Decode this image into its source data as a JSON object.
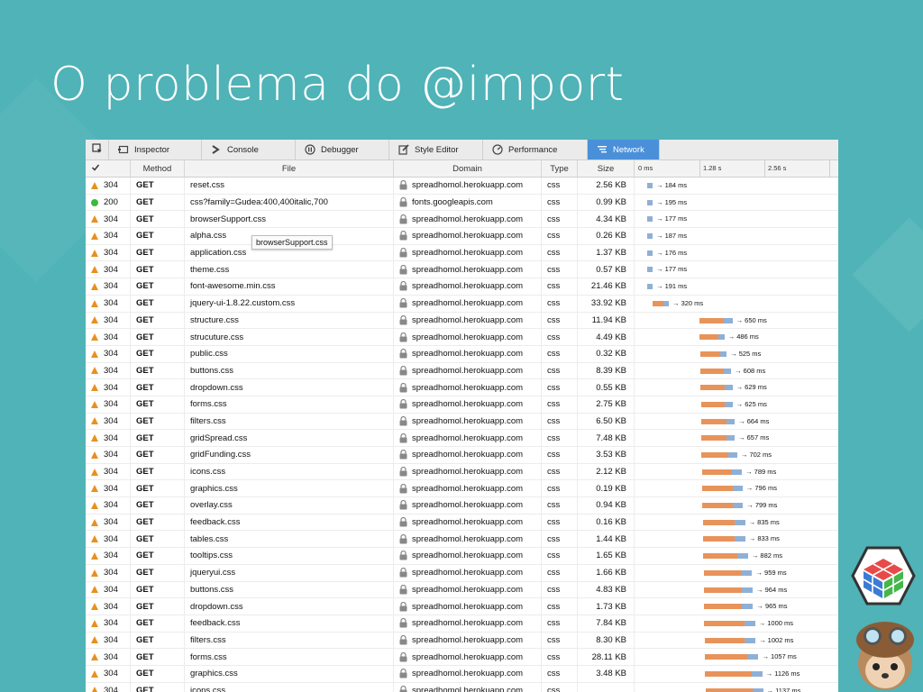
{
  "slide": {
    "title": "O problema do @import"
  },
  "toolbar": {
    "tabs": [
      {
        "label": "Inspector",
        "icon": "inspector-icon"
      },
      {
        "label": "Console",
        "icon": "console-icon"
      },
      {
        "label": "Debugger",
        "icon": "debugger-icon"
      },
      {
        "label": "Style Editor",
        "icon": "style-editor-icon"
      },
      {
        "label": "Performance",
        "icon": "performance-icon"
      },
      {
        "label": "Network",
        "icon": "network-icon",
        "active": true
      }
    ]
  },
  "columns": {
    "method": "Method",
    "file": "File",
    "domain": "Domain",
    "type": "Type",
    "size": "Size",
    "ticks": [
      "0 ms",
      "1.28 s",
      "2.56 s"
    ]
  },
  "tooltip": "browserSupport.css",
  "colors": {
    "background": "#4fb3b7",
    "wait": "#e8935a",
    "receive": "#8fb0d6",
    "warning": "#e8901f",
    "ok": "#3cba3c",
    "active_tab": "#4a90d9"
  },
  "requests": [
    {
      "status": "304",
      "method": "GET",
      "file": "reset.css",
      "domain": "spreadhomol.herokuapp.com",
      "type": "css",
      "size": "2.56 KB",
      "time": "→ 184 ms"
    },
    {
      "status": "200",
      "method": "GET",
      "file": "css?family=Gudea:400,400italic,700",
      "domain": "fonts.googleapis.com",
      "type": "css",
      "size": "0.99 KB",
      "time": "→ 195 ms"
    },
    {
      "status": "304",
      "method": "GET",
      "file": "browserSupport.css",
      "domain": "spreadhomol.herokuapp.com",
      "type": "css",
      "size": "4.34 KB",
      "time": "→ 177 ms"
    },
    {
      "status": "304",
      "method": "GET",
      "file": "alpha.css",
      "domain": "spreadhomol.herokuapp.com",
      "type": "css",
      "size": "0.26 KB",
      "time": "→ 187 ms"
    },
    {
      "status": "304",
      "method": "GET",
      "file": "application.css",
      "domain": "spreadhomol.herokuapp.com",
      "type": "css",
      "size": "1.37 KB",
      "time": "→ 176 ms"
    },
    {
      "status": "304",
      "method": "GET",
      "file": "theme.css",
      "domain": "spreadhomol.herokuapp.com",
      "type": "css",
      "size": "0.57 KB",
      "time": "→ 177 ms"
    },
    {
      "status": "304",
      "method": "GET",
      "file": "font-awesome.min.css",
      "domain": "spreadhomol.herokuapp.com",
      "type": "css",
      "size": "21.46 KB",
      "time": "→ 191 ms"
    },
    {
      "status": "304",
      "method": "GET",
      "file": "jquery-ui-1.8.22.custom.css",
      "domain": "spreadhomol.herokuapp.com",
      "type": "css",
      "size": "33.92 KB",
      "time": "→ 320 ms"
    },
    {
      "status": "304",
      "method": "GET",
      "file": "structure.css",
      "domain": "spreadhomol.herokuapp.com",
      "type": "css",
      "size": "11.94 KB",
      "time": "→ 650 ms"
    },
    {
      "status": "304",
      "method": "GET",
      "file": "strucuture.css",
      "domain": "spreadhomol.herokuapp.com",
      "type": "css",
      "size": "4.49 KB",
      "time": "→ 486 ms"
    },
    {
      "status": "304",
      "method": "GET",
      "file": "public.css",
      "domain": "spreadhomol.herokuapp.com",
      "type": "css",
      "size": "0.32 KB",
      "time": "→ 525 ms"
    },
    {
      "status": "304",
      "method": "GET",
      "file": "buttons.css",
      "domain": "spreadhomol.herokuapp.com",
      "type": "css",
      "size": "8.39 KB",
      "time": "→ 608 ms"
    },
    {
      "status": "304",
      "method": "GET",
      "file": "dropdown.css",
      "domain": "spreadhomol.herokuapp.com",
      "type": "css",
      "size": "0.55 KB",
      "time": "→ 629 ms"
    },
    {
      "status": "304",
      "method": "GET",
      "file": "forms.css",
      "domain": "spreadhomol.herokuapp.com",
      "type": "css",
      "size": "2.75 KB",
      "time": "→ 625 ms"
    },
    {
      "status": "304",
      "method": "GET",
      "file": "filters.css",
      "domain": "spreadhomol.herokuapp.com",
      "type": "css",
      "size": "6.50 KB",
      "time": "→ 664 ms"
    },
    {
      "status": "304",
      "method": "GET",
      "file": "gridSpread.css",
      "domain": "spreadhomol.herokuapp.com",
      "type": "css",
      "size": "7.48 KB",
      "time": "→ 657 ms"
    },
    {
      "status": "304",
      "method": "GET",
      "file": "gridFunding.css",
      "domain": "spreadhomol.herokuapp.com",
      "type": "css",
      "size": "3.53 KB",
      "time": "→ 702 ms"
    },
    {
      "status": "304",
      "method": "GET",
      "file": "icons.css",
      "domain": "spreadhomol.herokuapp.com",
      "type": "css",
      "size": "2.12 KB",
      "time": "→ 789 ms"
    },
    {
      "status": "304",
      "method": "GET",
      "file": "graphics.css",
      "domain": "spreadhomol.herokuapp.com",
      "type": "css",
      "size": "0.19 KB",
      "time": "→ 796 ms"
    },
    {
      "status": "304",
      "method": "GET",
      "file": "overlay.css",
      "domain": "spreadhomol.herokuapp.com",
      "type": "css",
      "size": "0.94 KB",
      "time": "→ 799 ms"
    },
    {
      "status": "304",
      "method": "GET",
      "file": "feedback.css",
      "domain": "spreadhomol.herokuapp.com",
      "type": "css",
      "size": "0.16 KB",
      "time": "→ 835 ms"
    },
    {
      "status": "304",
      "method": "GET",
      "file": "tables.css",
      "domain": "spreadhomol.herokuapp.com",
      "type": "css",
      "size": "1.44 KB",
      "time": "→ 833 ms"
    },
    {
      "status": "304",
      "method": "GET",
      "file": "tooltips.css",
      "domain": "spreadhomol.herokuapp.com",
      "type": "css",
      "size": "1.65 KB",
      "time": "→ 882 ms"
    },
    {
      "status": "304",
      "method": "GET",
      "file": "jqueryui.css",
      "domain": "spreadhomol.herokuapp.com",
      "type": "css",
      "size": "1.66 KB",
      "time": "→ 959 ms"
    },
    {
      "status": "304",
      "method": "GET",
      "file": "buttons.css",
      "domain": "spreadhomol.herokuapp.com",
      "type": "css",
      "size": "4.83 KB",
      "time": "→ 964 ms"
    },
    {
      "status": "304",
      "method": "GET",
      "file": "dropdown.css",
      "domain": "spreadhomol.herokuapp.com",
      "type": "css",
      "size": "1.73 KB",
      "time": "→ 965 ms"
    },
    {
      "status": "304",
      "method": "GET",
      "file": "feedback.css",
      "domain": "spreadhomol.herokuapp.com",
      "type": "css",
      "size": "7.84 KB",
      "time": "→ 1000 ms"
    },
    {
      "status": "304",
      "method": "GET",
      "file": "filters.css",
      "domain": "spreadhomol.herokuapp.com",
      "type": "css",
      "size": "8.30 KB",
      "time": "→ 1002 ms"
    },
    {
      "status": "304",
      "method": "GET",
      "file": "forms.css",
      "domain": "spreadhomol.herokuapp.com",
      "type": "css",
      "size": "28.11 KB",
      "time": "→ 1057 ms"
    },
    {
      "status": "304",
      "method": "GET",
      "file": "graphics.css",
      "domain": "spreadhomol.herokuapp.com",
      "type": "css",
      "size": "3.48 KB",
      "time": "→ 1126 ms"
    },
    {
      "status": "304",
      "method": "GET",
      "file": "icons.css",
      "domain": "spreadhomol.herokuapp.com",
      "type": "css",
      "size": "",
      "time": "→ 1137 ms"
    }
  ]
}
